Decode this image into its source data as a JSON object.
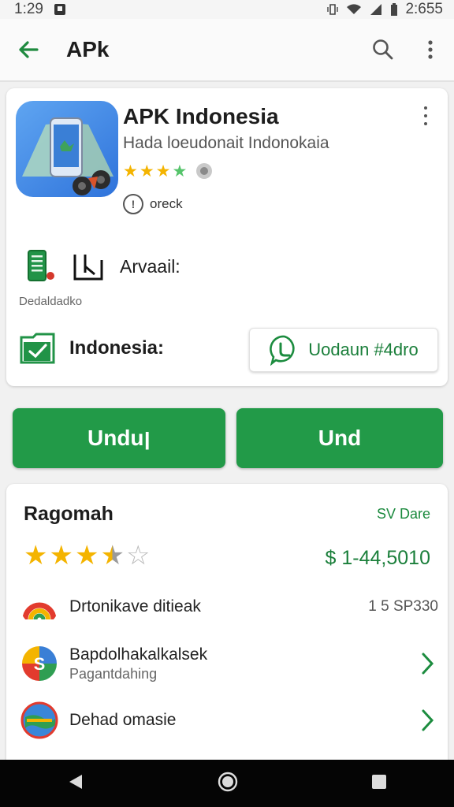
{
  "status_bar": {
    "time": "1:29",
    "clock_right": "2:655"
  },
  "app_bar": {
    "title": "APk",
    "back_icon": "arrow-left-icon",
    "search_icon": "search-icon",
    "more_icon": "more-vert-icon"
  },
  "app": {
    "name": "APK Indonesia",
    "subtitle": "Hada loeudonait Indonokaia",
    "rating_stars": 3.5,
    "info_text": "oreck",
    "available_label": "Arvaail:",
    "developer_label": "Dedaldadko",
    "region_label": "Indonesia:",
    "whatsapp_button": "Uodaun #4dro"
  },
  "actions": {
    "primary_left": "Unduן",
    "primary_right": "Und"
  },
  "ratings_section": {
    "title": "Ragomah",
    "link": "SV Dare",
    "stars": 3.5,
    "price": "$ 1-44,5010",
    "items": [
      {
        "title": "Drtonikave ditieak",
        "value": "1 5 SP330"
      },
      {
        "title": "Bapdolhakalkalsek",
        "subtitle": "Pagantdahing"
      },
      {
        "title": "Dehad omasie"
      }
    ]
  },
  "colors": {
    "accent": "#229a48",
    "star": "#f4b400",
    "nav": "#050505"
  }
}
